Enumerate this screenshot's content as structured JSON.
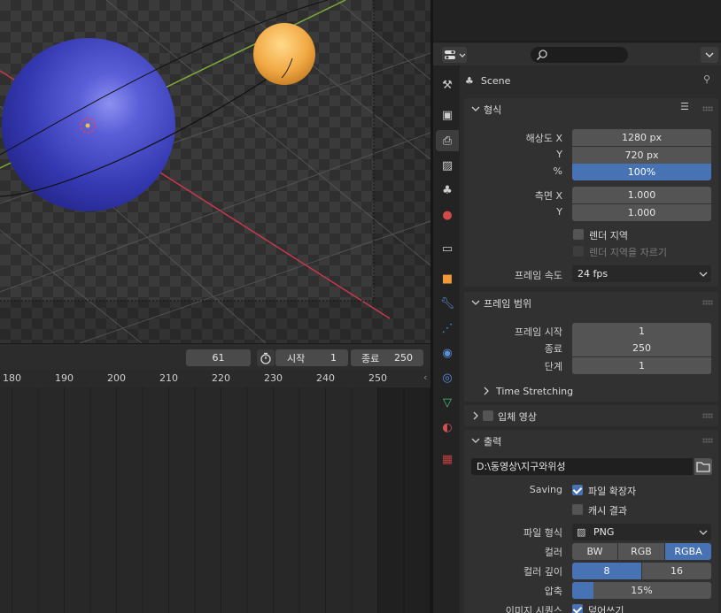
{
  "timeline": {
    "current_frame": "61",
    "start_label": "시작",
    "start_value": "1",
    "end_label": "종료",
    "end_value": "250",
    "ruler_ticks": [
      "180",
      "190",
      "200",
      "210",
      "220",
      "230",
      "240",
      "250"
    ]
  },
  "props": {
    "scene_label": "Scene",
    "format": {
      "title": "형식",
      "res_x_label": "해상도 X",
      "res_x": "1280 px",
      "res_y_label": "Y",
      "res_y": "720 px",
      "pct_label": "%",
      "pct": "100%",
      "aspect_x_label": "측면 X",
      "aspect_x": "1.000",
      "aspect_y_label": "Y",
      "aspect_y": "1.000",
      "render_region": "렌더 지역",
      "crop_region": "렌더 지역을 자르기",
      "fps_label": "프레임 속도",
      "fps": "24 fps"
    },
    "frame_range": {
      "title": "프레임 범위",
      "start_label": "프레임 시작",
      "start": "1",
      "end_label": "종료",
      "end": "250",
      "step_label": "단계",
      "step": "1",
      "time_stretching": "Time Stretching"
    },
    "stereo": {
      "title": "입체 영상"
    },
    "output": {
      "title": "출력",
      "path": "D:\\동영상\\지구와위성",
      "saving_label": "Saving",
      "file_ext": "파일 확장자",
      "cache_result": "캐시 결과",
      "file_format_label": "파일 형식",
      "file_format": "PNG",
      "color_label": "컬러",
      "color_options": [
        "BW",
        "RGB",
        "RGBA"
      ],
      "color_selected": "RGBA",
      "depth_label": "컬러 깊이",
      "depth_options": [
        "8",
        "16"
      ],
      "depth_selected": "8",
      "compression_label": "압축",
      "compression": "15%",
      "compression_fraction": 0.15,
      "image_seq_label": "이미지 시퀀스",
      "overwrite": "덮어쓰기"
    }
  },
  "colors": {
    "accent": "#4772b3",
    "planet": "#3b3fb5",
    "moon": "#f2aa45",
    "x_axis": "#c9384d",
    "y_axis": "#7da83a"
  }
}
